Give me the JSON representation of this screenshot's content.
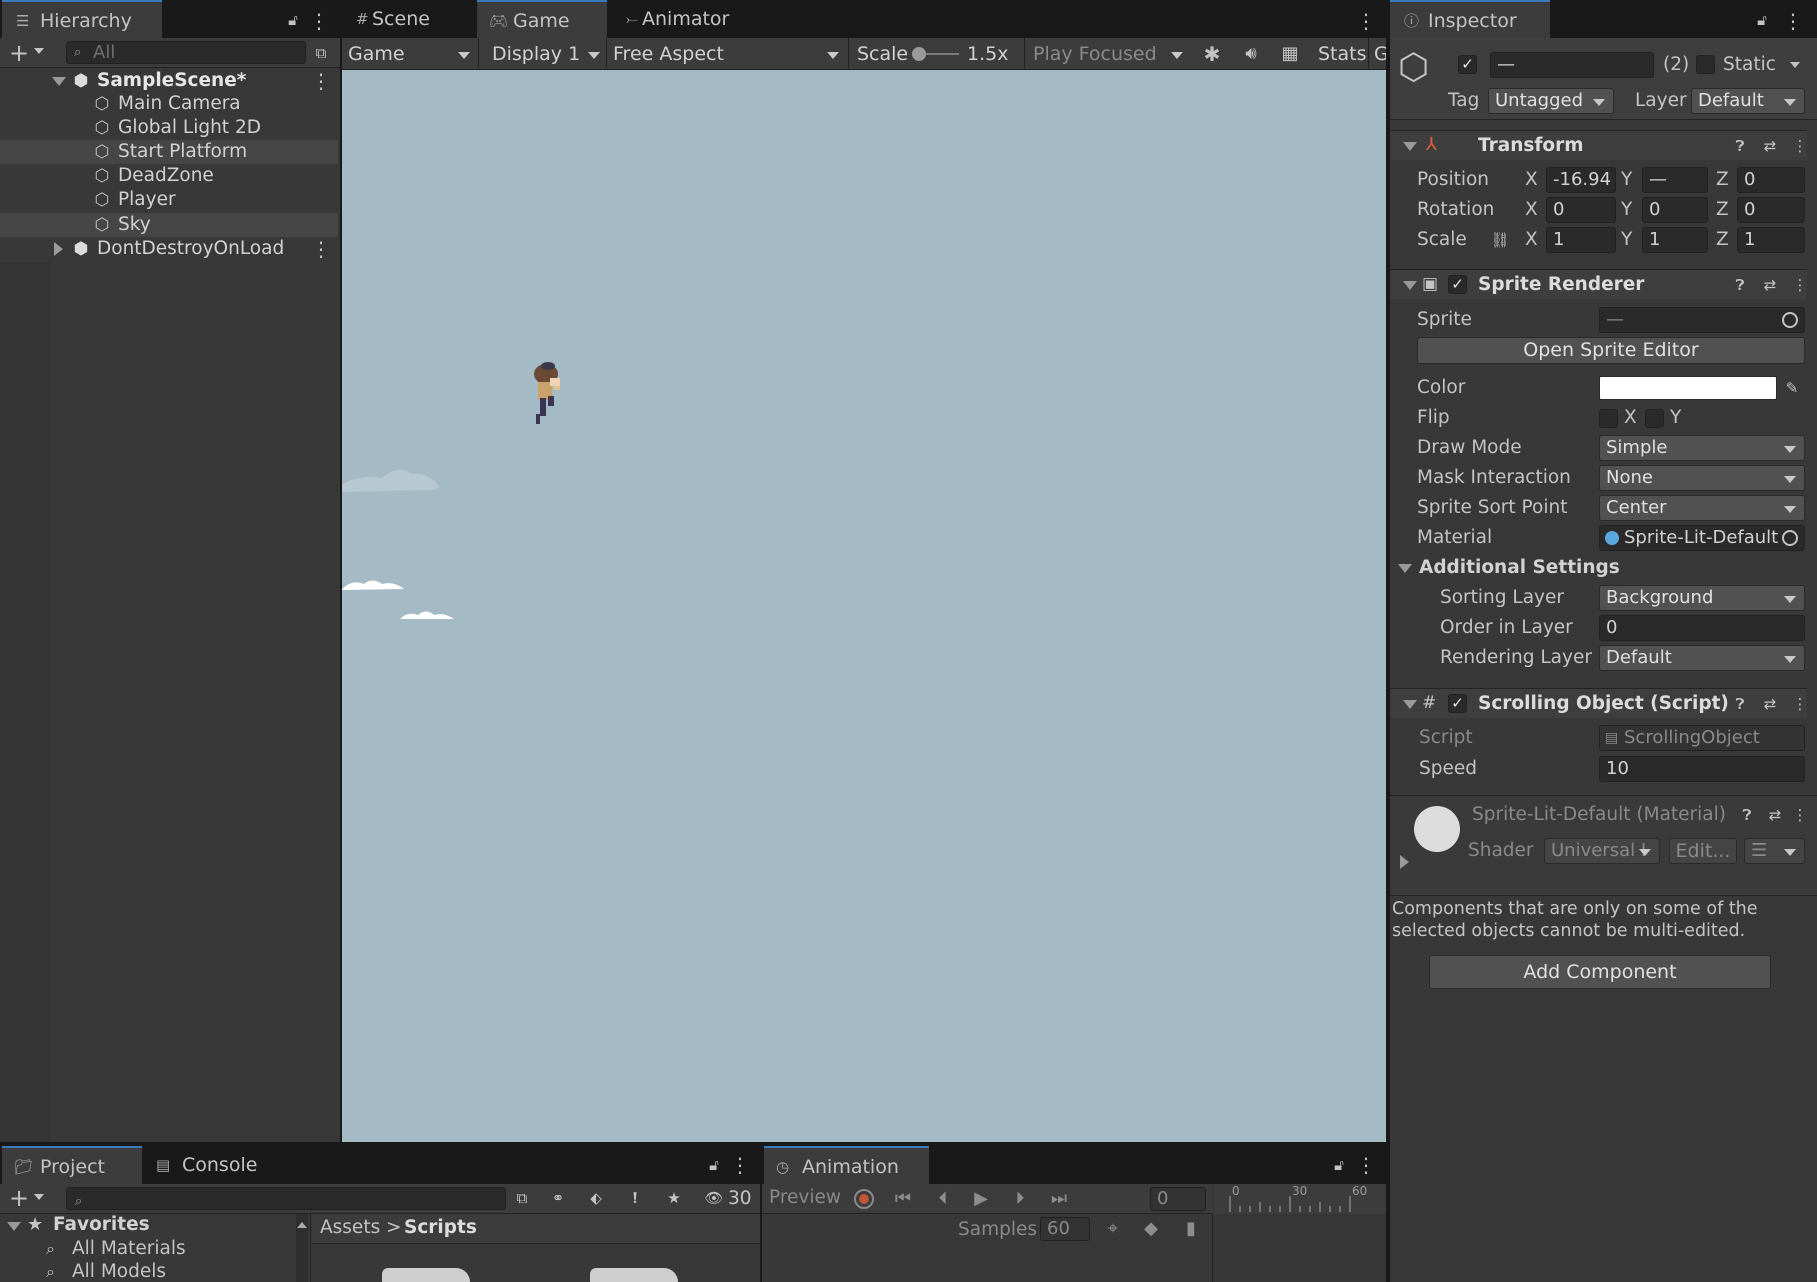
{
  "hierarchy": {
    "tab_label": "Hierarchy",
    "search_placeholder": "All",
    "scene": "SampleScene*",
    "items": [
      "Main Camera",
      "Global Light 2D",
      "Start Platform",
      "DeadZone",
      "Player",
      "Sky"
    ],
    "dontdestroy": "DontDestroyOnLoad"
  },
  "center_tabs": {
    "scene": "Scene",
    "game": "Game",
    "animator": "Animator"
  },
  "game_toolbar": {
    "mode": "Game",
    "display": "Display 1",
    "aspect": "Free Aspect",
    "scale_label": "Scale",
    "scale_value": "1.5x",
    "play_focused": "Play Focused",
    "stats": "Stats",
    "gizmos_short": "G"
  },
  "game_view": {
    "bg_color": "#a4bac4"
  },
  "inspector": {
    "tab_label": "Inspector",
    "name_value": "—",
    "multi_count": "(2)",
    "static_label": "Static",
    "tag_label": "Tag",
    "tag_value": "Untagged",
    "layer_label": "Layer",
    "layer_value": "Default",
    "transform": {
      "title": "Transform",
      "position_label": "Position",
      "rotation_label": "Rotation",
      "scale_label": "Scale",
      "position": {
        "x": "-16.94",
        "y": "—",
        "z": "0"
      },
      "rotation": {
        "x": "0",
        "y": "0",
        "z": "0"
      },
      "scale": {
        "x": "1",
        "y": "1",
        "z": "1"
      },
      "axis_x": "X",
      "axis_y": "Y",
      "axis_z": "Z"
    },
    "sprite_renderer": {
      "title": "Sprite Renderer",
      "sprite_label": "Sprite",
      "sprite_value": "—",
      "open_editor": "Open Sprite Editor",
      "color_label": "Color",
      "flip_label": "Flip",
      "flip_x": "X",
      "flip_y": "Y",
      "draw_mode_label": "Draw Mode",
      "draw_mode": "Simple",
      "mask_label": "Mask Interaction",
      "mask_value": "None",
      "sort_point_label": "Sprite Sort Point",
      "sort_point": "Center",
      "material_label": "Material",
      "material_value": "Sprite-Lit-Default",
      "additional": "Additional Settings",
      "sorting_layer_label": "Sorting Layer",
      "sorting_layer": "Background",
      "order_label": "Order in Layer",
      "order_value": "0",
      "rendering_layer_label": "Rendering Layer M",
      "rendering_layer": "Default"
    },
    "scrolling": {
      "title": "Scrolling Object (Script)",
      "script_label": "Script",
      "script_value": "ScrollingObject",
      "speed_label": "Speed",
      "speed_value": "10"
    },
    "material": {
      "title": "Sprite-Lit-Default (Material)",
      "shader_label": "Shader",
      "shader_value": "Universal I",
      "edit": "Edit..."
    },
    "note": "Components that are only on some of the selected objects cannot be multi-edited.",
    "add_component": "Add Component"
  },
  "project": {
    "tab_project": "Project",
    "tab_console": "Console",
    "hidden_count": "30",
    "favorites": "Favorites",
    "fav_items": [
      "All Materials",
      "All Models"
    ],
    "breadcrumb_root": "Assets",
    "breadcrumb_sep": ">",
    "breadcrumb_current": "Scripts"
  },
  "animation": {
    "tab_label": "Animation",
    "preview": "Preview",
    "frame": "0",
    "samples_label": "Samples",
    "samples_value": "60",
    "ruler": [
      "0",
      "30",
      "60"
    ]
  }
}
